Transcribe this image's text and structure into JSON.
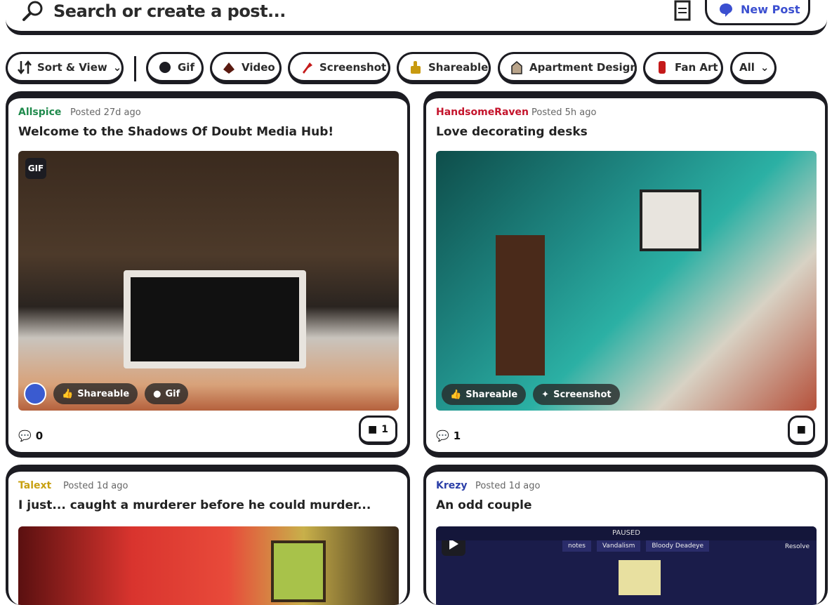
{
  "search": {
    "placeholder": "Search or create a post..."
  },
  "header": {
    "new_post_label": "New Post"
  },
  "filters": [
    {
      "label": "Sort & View",
      "icon": "sort-icon"
    },
    {
      "label": "Gif",
      "icon": "gif-icon"
    },
    {
      "label": "Video",
      "icon": "video-icon"
    },
    {
      "label": "Screenshot",
      "icon": "screenshot-icon"
    },
    {
      "label": "Shareable",
      "icon": "thumbs-up-icon"
    },
    {
      "label": "Apartment Design",
      "icon": "apartment-icon"
    },
    {
      "label": "Fan Art",
      "icon": "fan-art-icon"
    },
    {
      "label": "All",
      "icon": "chevron-down-icon"
    }
  ],
  "posts": [
    {
      "author": "Allspice",
      "author_color": "#1f8a4c",
      "time": "Posted 27d ago",
      "title": "Welcome to the Shadows Of Doubt Media Hub!",
      "media_badge": "GIF",
      "tags": [
        "Shareable",
        "Gif"
      ],
      "comments": "0",
      "reactions": "1"
    },
    {
      "author": "HandsomeRaven",
      "author_color": "#c4142c",
      "time": "Posted 5h ago",
      "title": "Love decorating desks",
      "tags": [
        "Shareable",
        "Screenshot"
      ],
      "comments": "1",
      "reactions": ""
    },
    {
      "author": "Talext",
      "author_color": "#c8a010",
      "time": "Posted 1d ago",
      "title": "I just... caught a murderer before he could murder..."
    },
    {
      "author": "Krezy",
      "author_color": "#2b3fa8",
      "time": "Posted 1d ago",
      "title": "An odd couple",
      "media_text": [
        "PAUSED",
        "notes",
        "Vandalism",
        "Bloody Deadeye",
        "Resolve"
      ]
    }
  ]
}
